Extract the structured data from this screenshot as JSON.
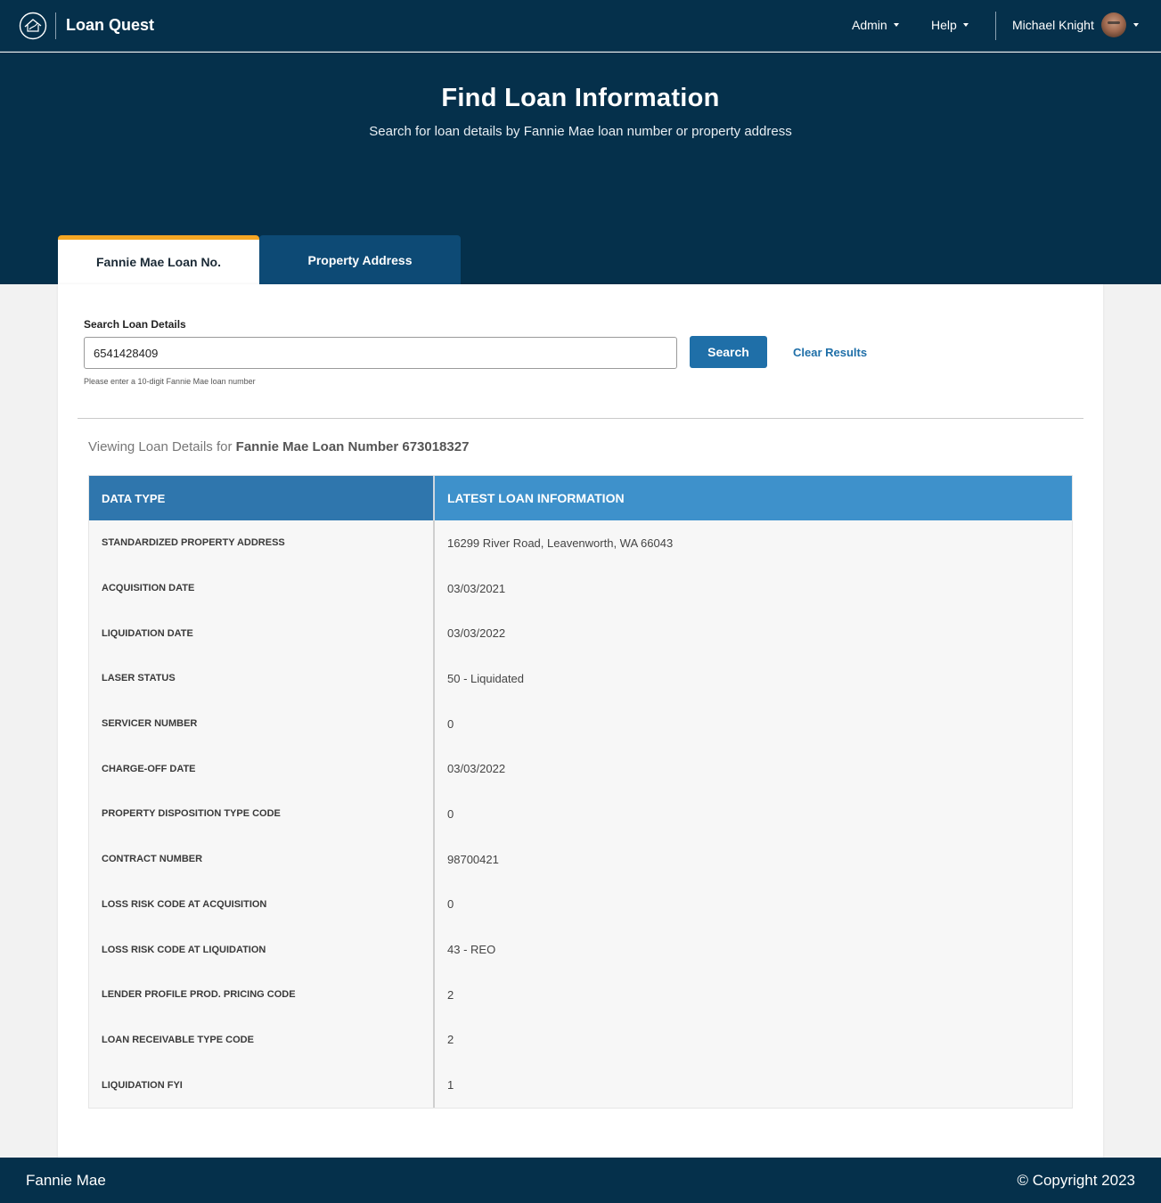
{
  "app": {
    "title": "Loan Quest",
    "logo_icon": "fannie-mae-house-logo"
  },
  "nav": {
    "admin_label": "Admin",
    "help_label": "Help",
    "user_name": "Michael Knight"
  },
  "hero": {
    "title": "Find Loan Information",
    "subtitle": "Search for loan details by Fannie Mae loan number or property address"
  },
  "tabs": [
    {
      "label": "Fannie Mae Loan No.",
      "active": true
    },
    {
      "label": "Property Address",
      "active": false
    }
  ],
  "search": {
    "label": "Search Loan Details",
    "value": "6541428409",
    "hint": "Please enter a 10-digit Fannie Mae loan number",
    "button_label": "Search",
    "clear_label": "Clear Results"
  },
  "results": {
    "viewing_prefix": "Viewing Loan Details for ",
    "viewing_subject": "Fannie Mae Loan Number 673018327",
    "columns": [
      "DATA TYPE",
      "LATEST LOAN INFORMATION"
    ],
    "rows": [
      [
        "STANDARDIZED PROPERTY ADDRESS",
        "16299 River Road, Leavenworth, WA 66043"
      ],
      [
        "ACQUISITION DATE",
        "03/03/2021"
      ],
      [
        "LIQUIDATION DATE",
        "03/03/2022"
      ],
      [
        "LASER STATUS",
        "50 - Liquidated"
      ],
      [
        "SERVICER NUMBER",
        "0"
      ],
      [
        "CHARGE-OFF DATE",
        "03/03/2022"
      ],
      [
        "PROPERTY DISPOSITION TYPE CODE",
        "0"
      ],
      [
        "CONTRACT NUMBER",
        "98700421"
      ],
      [
        "LOSS RISK CODE AT ACQUISITION",
        "0"
      ],
      [
        "LOSS RISK CODE AT LIQUIDATION",
        "43 - REO"
      ],
      [
        "LENDER PROFILE PROD. PRICING CODE",
        "2"
      ],
      [
        "LOAN RECEIVABLE TYPE CODE",
        "2"
      ],
      [
        "LIQUIDATION FYI",
        "1"
      ]
    ]
  },
  "footer": {
    "left": "Fannie Mae",
    "right": "© Copyright 2023"
  },
  "colors": {
    "navy": "#05304b",
    "tab_accent": "#f5a623",
    "primary_button": "#1f6fa8",
    "table_header_left": "#2f76ad",
    "table_header_right": "#3e91cb"
  }
}
